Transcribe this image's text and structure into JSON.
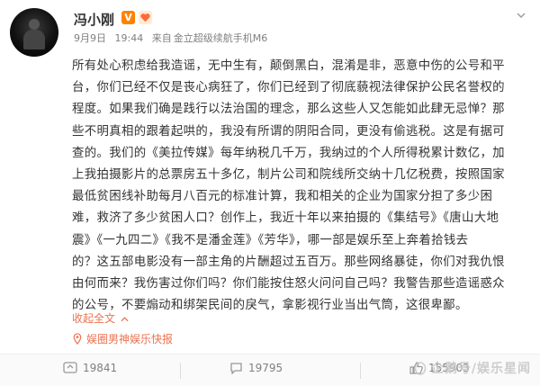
{
  "author": {
    "name": "冯小刚",
    "vip_badge": "V"
  },
  "meta": {
    "date": "9月9日",
    "time": "19:44",
    "source": "来自",
    "device": "金立超级续航手机M6"
  },
  "post": {
    "lines": [
      "所有处心积虑给我造谣，无中生有，颠倒黑白，混淆是非，恶意中伤的公号和平",
      "台，你们已经不仅是丧心病狂了，你们已经到了彻底藐视法律保护公民名誉权的",
      "程度。如果我们确是践行以法治国的理念，那么这些人又怎能如此肆无忌惮？那",
      "些不明真相的跟着起哄的，我没有所谓的阴阳合同，更没有偷逃税。这是有据可",
      "查的。我们的《美拉传媒》每年纳税几千万，我纳过的个人所得税累计数亿，加",
      "上我拍摄影片的总票房五十多亿，制片公司和院线所交纳十几亿税费，按照国家",
      "最低贫困线补助每月八百元的标准计算，我和相关的企业为国家分担了多少困",
      "难，救济了多少贫困人口？创作上，我近十年以来拍摄的《集结号》《唐山大地",
      "震》《一九四二》《我不是潘金莲》《芳华》，哪一部是娱乐至上奔着拾钱去",
      "的？这五部电影没有一部主角的片酬超过五百万。那些网络暴徒，你们对我仇恨",
      "由何而来？我伤害过你们吗？你们能按住怒火问问自己吗？我警告那些造谣惑众",
      "的公号，不要煽动和绑架民间的戾气，拿影视行业当出气筒，这很卑鄙。"
    ]
  },
  "collapse_label": "收起全文",
  "source_tag": "娱圈男神娱乐快报",
  "actions": {
    "repost_count": "19841",
    "comment_count": "19795",
    "like_count": "155903"
  },
  "watermark": "企鹅号/娱乐星闻",
  "colors": {
    "accent": "#eb7350",
    "vip": "#ff8200",
    "text": "#333333",
    "muted": "#808080"
  },
  "icons": {
    "repost": "repost-icon",
    "comment": "comment-icon",
    "like": "like-icon",
    "source": "location-pin-icon",
    "more": "chevron-down-icon"
  }
}
